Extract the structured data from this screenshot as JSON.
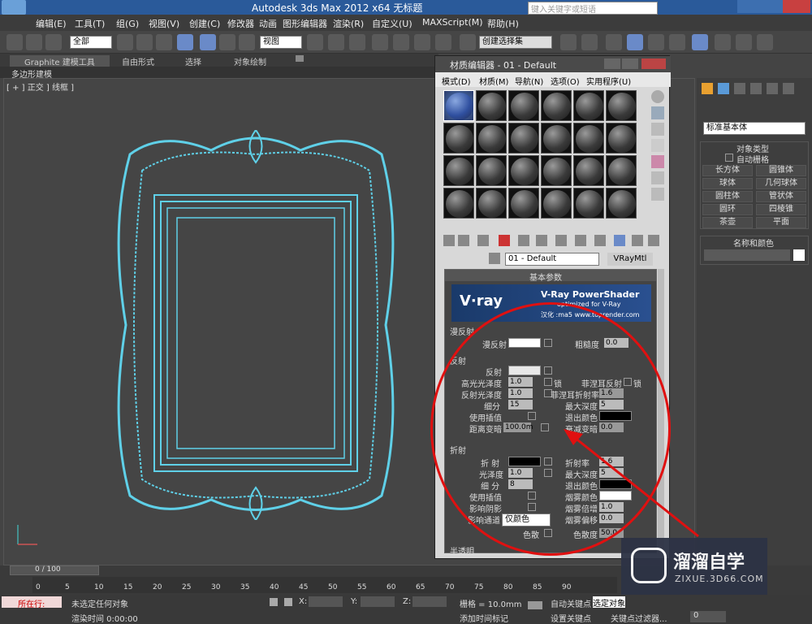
{
  "window": {
    "title": "Autodesk 3ds Max  2012 x64    无标题",
    "search_placeholder": "键入关键字或短语"
  },
  "menu": [
    "编辑(E)",
    "工具(T)",
    "组(G)",
    "视图(V)",
    "创建(C)",
    "修改器",
    "动画",
    "图形编辑器",
    "渲染(R)",
    "自定义(U)",
    "MAXScript(M)",
    "帮助(H)"
  ],
  "toolbar": {
    "filter": "全部",
    "view": "视图",
    "selection_set": "创建选择集"
  },
  "ribbon": {
    "tabs": [
      "Graphite 建模工具",
      "自由形式",
      "选择",
      "对象绘制"
    ],
    "sub": "多边形建模"
  },
  "viewport": {
    "label": "[ + ] 正交 ] 线框 ]"
  },
  "command_panel": {
    "dropdown": "标准基本体",
    "rollout_object_type": "对象类型",
    "autogrid": "自动栅格",
    "buttons": [
      "长方体",
      "圆锥体",
      "球体",
      "几何球体",
      "圆柱体",
      "管状体",
      "圆环",
      "四棱锥",
      "茶壶",
      "平面"
    ],
    "rollout_name_color": "名称和颜色"
  },
  "material_editor": {
    "title": "材质编辑器 - 01 - Default",
    "menus": [
      "模式(D)",
      "材质(M)",
      "导航(N)",
      "选项(O)",
      "实用程序(U)"
    ],
    "material_name": "01 - Default",
    "material_type": "VRayMtl",
    "rollout": "基本参数",
    "banner": {
      "main": "V-Ray PowerShader",
      "sub": "optimized for V-Ray",
      "credit": "汉化 :ma5 www.toprender.com"
    },
    "diffuse": {
      "group": "漫反射",
      "diffuse": "漫反射",
      "roughness": "粗糙度",
      "roughness_val": "0.0"
    },
    "reflect": {
      "group": "反射",
      "reflect": "反射",
      "hilight": "高光光泽度",
      "hilight_val": "1.0",
      "refl_gloss": "反射光泽度",
      "refl_gloss_val": "1.0",
      "subdivs": "细分",
      "subdivs_val": "15",
      "use_interp": "使用插值",
      "dim_dist": "距离变暗",
      "dim_dist_val": "100.0m",
      "lock": "锁",
      "fresnel": "菲涅耳反射",
      "fresnel_ior": "菲涅耳折射率",
      "fresnel_ior_val": "1.6",
      "max_depth": "最大深度",
      "max_depth_val": "5",
      "exit_color": "退出颜色",
      "dim_falloff": "衰减变暗",
      "dim_falloff_val": "0.0"
    },
    "refract": {
      "group": "折射",
      "refract": "折 射",
      "gloss": "光泽度",
      "gloss_val": "1.0",
      "subdivs": "细 分",
      "subdivs_val": "8",
      "use_interp": "使用插值",
      "shadows": "影响阴影",
      "affect_ch": "影响通道",
      "affect_ch_val": "仅颜色",
      "dispersion": "色散",
      "ior": "折射率",
      "ior_val": "1.6",
      "max_depth": "最大深度",
      "max_depth_val": "5",
      "exit_color": "退出颜色",
      "fog_color": "烟雾颜色",
      "fog_mult": "烟雾倍增",
      "fog_mult_val": "1.0",
      "fog_bias": "烟雾偏移",
      "fog_bias_val": "0.0",
      "abbe": "色散度",
      "abbe_val": "50.0"
    },
    "translucency": "半透明"
  },
  "timeline": {
    "frame": "0 / 100",
    "ticks": [
      "0",
      "5",
      "10",
      "15",
      "20",
      "25",
      "30",
      "35",
      "40",
      "45",
      "50",
      "55",
      "60",
      "65",
      "70",
      "75",
      "80",
      "85",
      "90"
    ]
  },
  "status": {
    "running": "所在行:",
    "msg": "未选定任何对象",
    "render_time": "渲染时间 0:00:00",
    "x": "X:",
    "y": "Y:",
    "z": "Z:",
    "grid": "栅格 = 10.0mm",
    "add_tag": "添加时间标记",
    "auto_key": "自动关键点",
    "set_key": "设置关键点",
    "selected": "选定对象",
    "key_filters": "关键点过滤器...",
    "frame_val": "0"
  },
  "watermark": {
    "brand": "溜溜自学",
    "url": "ZIXUE.3D66.COM"
  },
  "colors": {
    "wire": "#5fd0e8",
    "annotation": "#e01010",
    "title": "#2a5a9a"
  }
}
